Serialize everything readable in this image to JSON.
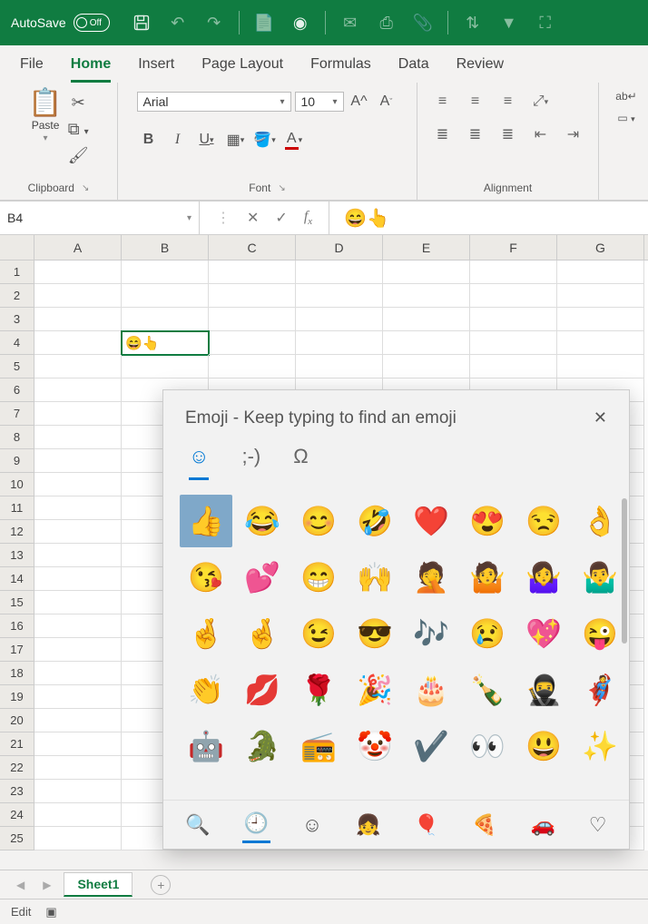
{
  "titlebar": {
    "autosave_label": "AutoSave",
    "autosave_state": "Off"
  },
  "ribbon_tabs": [
    "File",
    "Home",
    "Insert",
    "Page Layout",
    "Formulas",
    "Data",
    "Review"
  ],
  "active_ribbon_tab": "Home",
  "clipboard": {
    "paste_label": "Paste",
    "group_label": "Clipboard"
  },
  "font": {
    "name": "Arial",
    "size": "10",
    "group_label": "Font"
  },
  "alignment": {
    "group_label": "Alignment"
  },
  "name_box": "B4",
  "formula_bar_value": "😄👆",
  "columns": [
    "A",
    "B",
    "C",
    "D",
    "E",
    "F",
    "G"
  ],
  "row_count": 25,
  "active_cell": {
    "row": 4,
    "col": "B",
    "value": "😄👆"
  },
  "picker": {
    "title": "Emoji - Keep typing to find an emoji",
    "tabs": [
      "☺",
      ";-)",
      "Ω"
    ],
    "active_tab": 0,
    "grid": [
      [
        "👍",
        "😂",
        "😊",
        "🤣",
        "❤️",
        "😍",
        "😒",
        "👌"
      ],
      [
        "😘",
        "💕",
        "😁",
        "🙌",
        "🤦",
        "🤷",
        "🤷‍♀️",
        "🤷‍♂️"
      ],
      [
        "🤞",
        "🤞",
        "😉",
        "😎",
        "🎶",
        "😢",
        "💖",
        "😜"
      ],
      [
        "👏",
        "💋",
        "🌹",
        "🎉",
        "🎂",
        "🍾",
        "🥷",
        "🦸"
      ],
      [
        "🤖",
        "🐊",
        "📻",
        "🤡",
        "✔️",
        "👀",
        "😃",
        "✨"
      ]
    ],
    "selected": [
      0,
      0
    ],
    "categories": [
      "🔍",
      "🕘",
      "☺",
      "👧",
      "🎈",
      "🍕",
      "🚗",
      "♡"
    ],
    "active_category": 1
  },
  "sheet_tab": "Sheet1",
  "status_mode": "Edit"
}
